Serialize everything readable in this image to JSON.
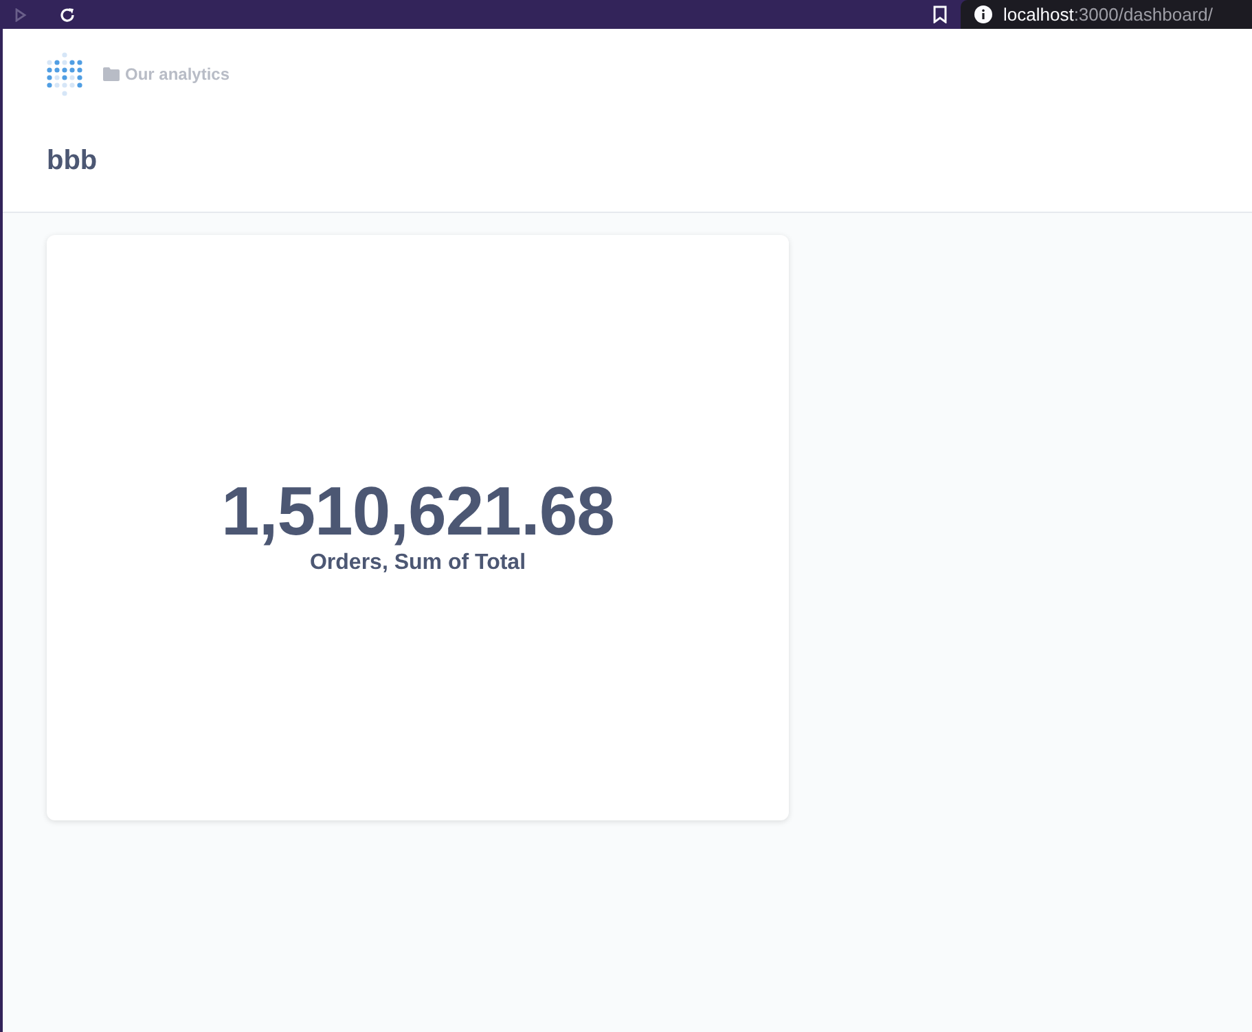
{
  "browser": {
    "url_host": "localhost",
    "url_path": ":3000/dashboard/"
  },
  "header": {
    "breadcrumb": "Our analytics",
    "title": "bbb"
  },
  "cards": [
    {
      "value": "1,510,621.68",
      "label": "Orders, Sum of Total"
    }
  ]
}
